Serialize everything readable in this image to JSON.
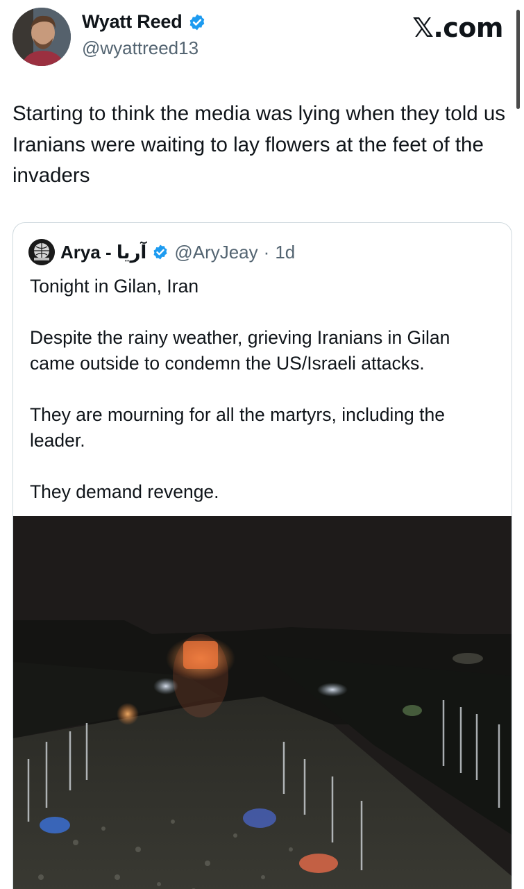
{
  "header": {
    "author_name": "Wyatt Reed",
    "author_handle": "@wyattreed13",
    "site_logo": "𝕏.com",
    "verified_icon": "verified-badge-icon",
    "colors": {
      "verified": "#1d9bf0",
      "secondary_text": "#536471"
    }
  },
  "tweet": {
    "text": "Starting to think the media was lying when they told us Iranians were waiting to lay flowers at the feet of the invaders"
  },
  "quote": {
    "name": "Arya - آریا",
    "handle": "@AryJeay",
    "separator": "·",
    "time": "1d",
    "paragraphs": [
      "Tonight in Gilan, Iran",
      "Despite the rainy weather, grieving Iranians in Gilan came outside to condemn the US/Israeli attacks.",
      "They are mourning for all the martyrs, including the leader.",
      "They demand revenge."
    ],
    "media": {
      "icon": "night-crowd-photo"
    }
  }
}
